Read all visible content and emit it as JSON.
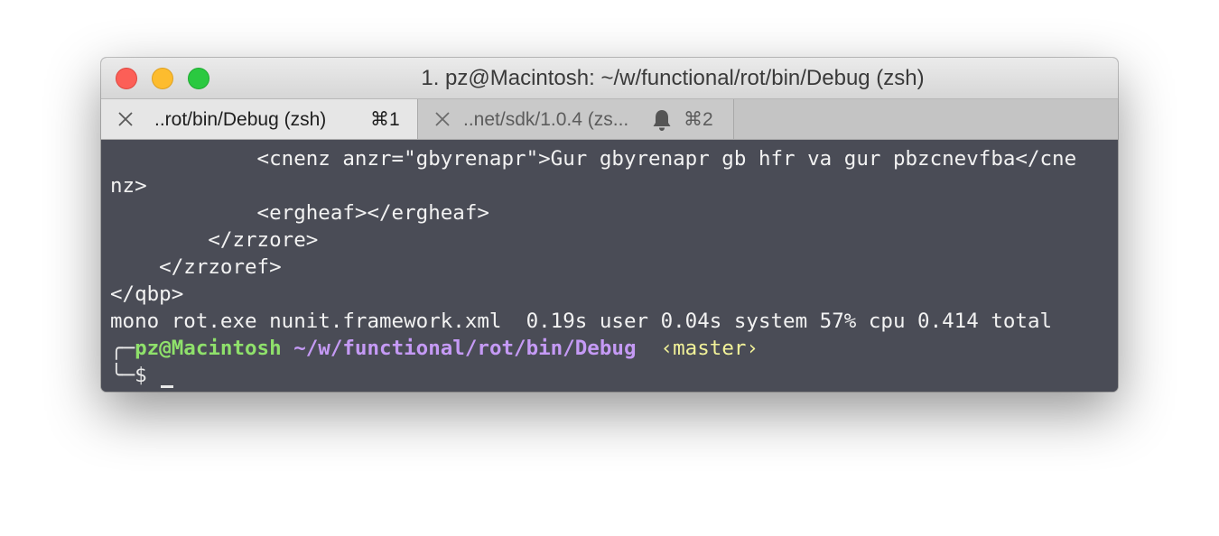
{
  "window": {
    "title": "1. pz@Macintosh: ~/w/functional/rot/bin/Debug (zsh)"
  },
  "tabs": [
    {
      "label": "..rot/bin/Debug (zsh)",
      "shortcut": "⌘1",
      "close_icon": "close-icon"
    },
    {
      "label": "..net/sdk/1.0.4 (zs...",
      "shortcut": "⌘2",
      "close_icon": "close-icon",
      "notification_icon": "bell-icon"
    }
  ],
  "terminal": {
    "lines": [
      "            <cnenz anzr=\"gbyrenapr\">Gur gbyrenapr gb hfr va gur pbzcnevfba</cne",
      "nz>",
      "            <ergheaf></ergheaf>",
      "        </zrzore>",
      "    </zrzoref>",
      "</qbp>",
      "mono rot.exe nunit.framework.xml  0.19s user 0.04s system 57% cpu 0.414 total"
    ],
    "prompt": {
      "corner_top": "╭─",
      "user_host": "pz@Macintosh",
      "path": "~/w/functional/rot/bin/Debug",
      "branch": "‹master›",
      "corner_bottom": "╰─",
      "symbol": "$"
    }
  },
  "colors": {
    "terminal_bg": "#4a4c56",
    "user_host": "#8fe16b",
    "path": "#c59af5",
    "branch": "#f2f299"
  }
}
